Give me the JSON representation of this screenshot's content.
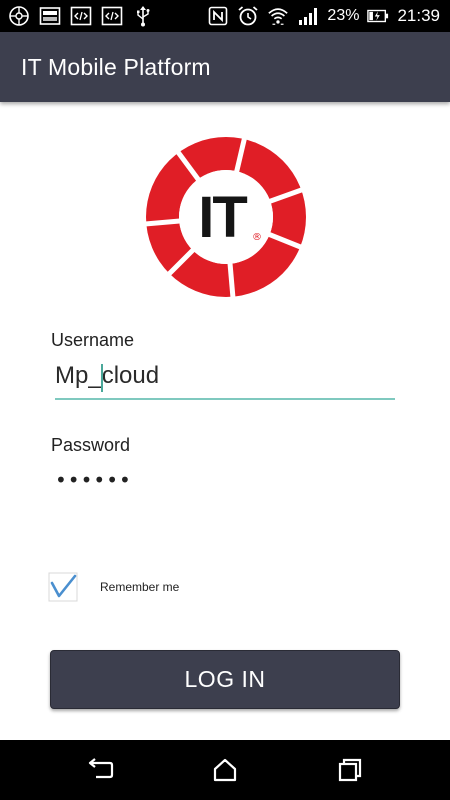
{
  "status_bar": {
    "battery_percent": "23%",
    "time": "21:39",
    "icons_left": [
      "vpn-icon",
      "image-icon",
      "code-icon",
      "code-icon",
      "usb-icon"
    ],
    "icons_right": [
      "nfc-icon",
      "alarm-icon",
      "wifi-icon",
      "signal-icon",
      "battery-charging-icon"
    ]
  },
  "app_bar": {
    "title": "IT Mobile Platform"
  },
  "logo": {
    "text": "IT",
    "registered_mark": "®",
    "brand_color": "#e01e26"
  },
  "login_form": {
    "username_label": "Username",
    "username_value": "Mp_cloud",
    "password_label": "Password",
    "password_value": "••••••",
    "remember_label": "Remember me",
    "remember_checked": true,
    "login_button_label": "LOG IN"
  },
  "nav_bar": {
    "buttons": [
      "back-icon",
      "home-icon",
      "recents-icon"
    ]
  },
  "colors": {
    "app_bar": "#3d3f4e",
    "input_underline": "#7fc9bf",
    "check_color": "#4a8fcf"
  }
}
